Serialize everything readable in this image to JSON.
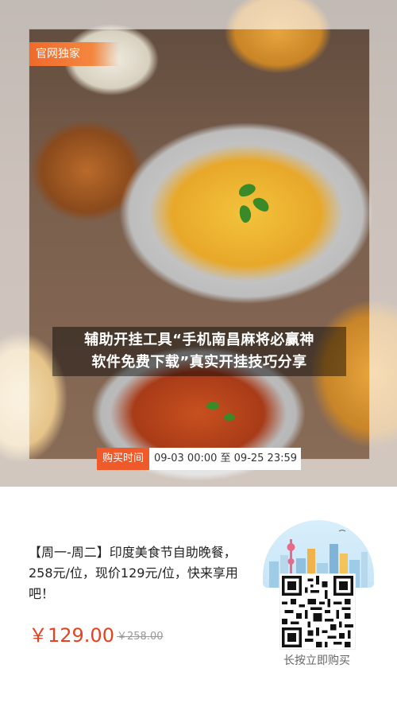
{
  "hero": {
    "badge": "官网独家",
    "title_line1": "辅助开挂工具“手机南昌麻将必赢神",
    "title_line2": "软件免费下载”真实开挂技巧分享",
    "buy_label": "购买时间",
    "buy_time": "09-03 00:00 至 09-25 23:59"
  },
  "deal": {
    "description": "【周一-周二】印度美食节自助晚餐，258元/位，现价129元/位，快来享用吧！",
    "price": "￥129.00",
    "original_price": "￥258.00"
  },
  "qr": {
    "caption": "长按立即购买"
  },
  "colors": {
    "accent": "#ef5a2a",
    "price": "#e8411f"
  }
}
